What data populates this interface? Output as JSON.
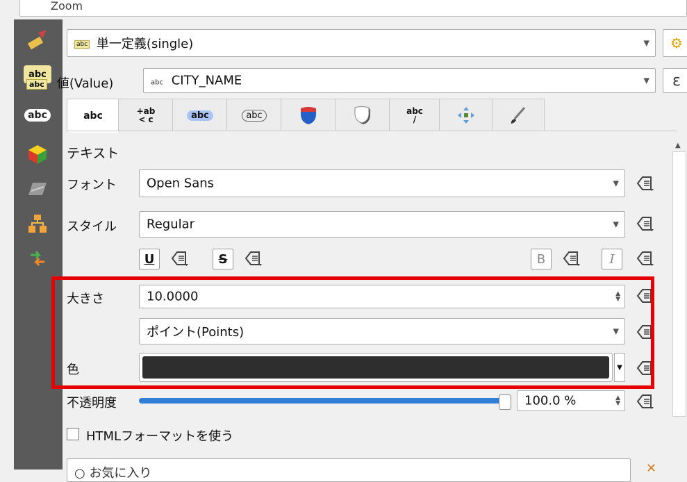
{
  "top_bar": {
    "partial_text": "Zoom"
  },
  "renderer_combo": {
    "value": "単一定義(single)"
  },
  "value_row": {
    "label": "値(Value)",
    "field": "CITY_NAME",
    "expr_button": "ε"
  },
  "tabs": [
    {
      "name": "text",
      "glyph": "abc"
    },
    {
      "name": "formatting",
      "glyph": "+ab\n< c"
    },
    {
      "name": "buffer",
      "glyph": "abc"
    },
    {
      "name": "mask",
      "glyph": "abc"
    },
    {
      "name": "background",
      "glyph": ""
    },
    {
      "name": "shadow",
      "glyph": ""
    },
    {
      "name": "callouts",
      "glyph": "abc"
    },
    {
      "name": "placement",
      "glyph": ""
    },
    {
      "name": "rendering",
      "glyph": ""
    }
  ],
  "section_title": "テキスト",
  "font": {
    "label": "フォント",
    "value": "Open Sans"
  },
  "style": {
    "label": "スタイル",
    "value": "Regular"
  },
  "format_buttons": {
    "underline": "U",
    "strike": "S",
    "bold": "B",
    "italic": "I"
  },
  "size": {
    "label": "大きさ",
    "value": "10.0000"
  },
  "unit": {
    "value": "ポイント(Points)"
  },
  "color": {
    "label": "色",
    "swatch": "#2e2e2e"
  },
  "opacity": {
    "label": "不透明度",
    "value": "100.0 %",
    "level": 1.0
  },
  "html_format": {
    "label": "HTMLフォーマットを使う",
    "checked": false
  },
  "favorites": {
    "partial_text": "お気に入り"
  },
  "highlight_color": "#e60000"
}
